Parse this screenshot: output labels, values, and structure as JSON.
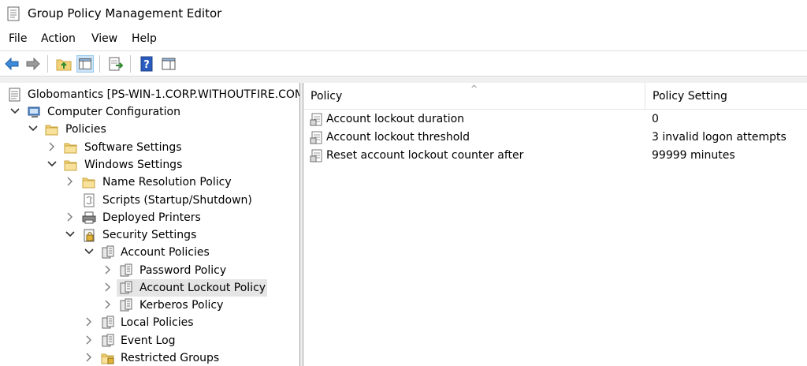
{
  "window": {
    "title": "Group Policy Management Editor"
  },
  "menu": [
    "File",
    "Action",
    "View",
    "Help"
  ],
  "toolbar": {
    "buttons": [
      "back-arrow-icon",
      "forward-arrow-icon",
      "up-folder-icon",
      "show-hide-tree-icon",
      "export-list-icon",
      "help-icon",
      "show-action-pane-icon"
    ]
  },
  "tree": {
    "root": "Globomantics [PS-WIN-1.CORP.WITHOUTFIRE.COM",
    "computer_configuration": "Computer Configuration",
    "policies": "Policies",
    "software_settings": "Software Settings",
    "windows_settings": "Windows Settings",
    "name_resolution_policy": "Name Resolution Policy",
    "scripts": "Scripts (Startup/Shutdown)",
    "deployed_printers": "Deployed Printers",
    "security_settings": "Security Settings",
    "account_policies": "Account Policies",
    "password_policy": "Password Policy",
    "account_lockout_policy": "Account Lockout Policy",
    "kerberos_policy": "Kerberos Policy",
    "local_policies": "Local Policies",
    "event_log": "Event Log",
    "restricted_groups": "Restricted Groups"
  },
  "list": {
    "columns": [
      "Policy",
      "Policy Setting"
    ],
    "sort_indicator": "^",
    "rows": [
      {
        "policy": "Account lockout duration",
        "setting": "0"
      },
      {
        "policy": "Account lockout threshold",
        "setting": "3 invalid logon attempts"
      },
      {
        "policy": "Reset account lockout counter after",
        "setting": "99999 minutes"
      }
    ]
  },
  "colors": {
    "selection": "#e5e5e5",
    "folder": "#f3d27a",
    "nav_arrow_blue": "#3c8ad8"
  }
}
